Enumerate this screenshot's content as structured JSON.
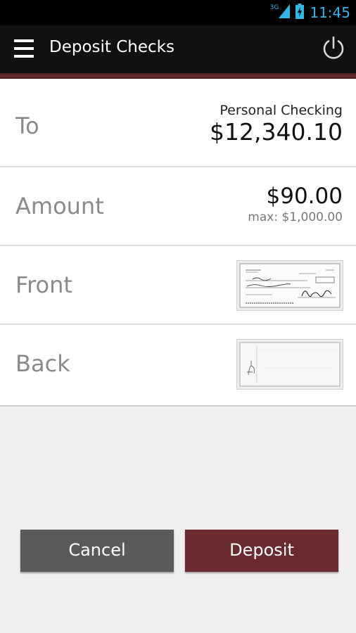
{
  "status_bar": {
    "network_type": "3G",
    "time": "11:45",
    "icons": [
      "signal-icon",
      "battery-charging-icon"
    ],
    "accent_color": "#33b5e5"
  },
  "app_bar": {
    "title": "Deposit Checks",
    "icons": [
      "menu-icon",
      "power-icon"
    ],
    "accent_color": "#6b2c2c"
  },
  "form": {
    "to": {
      "label": "To",
      "account_name": "Personal Checking",
      "account_balance": "$12,340.10"
    },
    "amount": {
      "label": "Amount",
      "value": "$90.00",
      "max": "max: $1,000.00"
    },
    "front": {
      "label": "Front",
      "image": "check-front-thumbnail"
    },
    "back": {
      "label": "Back",
      "image": "check-back-thumbnail"
    }
  },
  "buttons": {
    "cancel_label": "Cancel",
    "deposit_label": "Deposit",
    "cancel_color": "#5a5a5a",
    "deposit_color": "#6b2a2e"
  }
}
